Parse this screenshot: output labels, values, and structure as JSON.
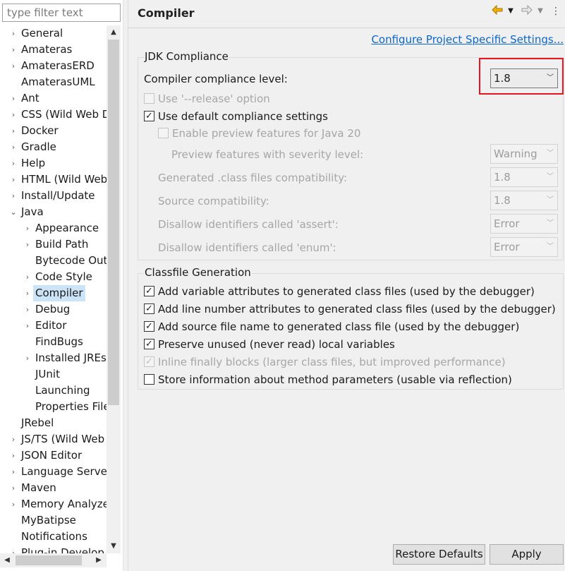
{
  "filter": {
    "placeholder": "type filter text",
    "value": ""
  },
  "tree": {
    "items": [
      {
        "label": "General",
        "expander": "›"
      },
      {
        "label": "Amateras",
        "expander": "›"
      },
      {
        "label": "AmaterasERD",
        "expander": "›"
      },
      {
        "label": "AmaterasUML",
        "expander": ""
      },
      {
        "label": "Ant",
        "expander": "›"
      },
      {
        "label": "CSS (Wild Web D",
        "expander": "›"
      },
      {
        "label": "Docker",
        "expander": "›"
      },
      {
        "label": "Gradle",
        "expander": "›"
      },
      {
        "label": "Help",
        "expander": "›"
      },
      {
        "label": "HTML (Wild Web",
        "expander": "›"
      },
      {
        "label": "Install/Update",
        "expander": "›"
      },
      {
        "label": "Java",
        "expander": "⌄"
      },
      {
        "label": "Appearance",
        "expander": "›"
      },
      {
        "label": "Build Path",
        "expander": "›"
      },
      {
        "label": "Bytecode Out",
        "expander": ""
      },
      {
        "label": "Code Style",
        "expander": "›"
      },
      {
        "label": "Compiler",
        "expander": "›"
      },
      {
        "label": "Debug",
        "expander": "›"
      },
      {
        "label": "Editor",
        "expander": "›"
      },
      {
        "label": "FindBugs",
        "expander": ""
      },
      {
        "label": "Installed JREs",
        "expander": "›"
      },
      {
        "label": "JUnit",
        "expander": ""
      },
      {
        "label": "Launching",
        "expander": ""
      },
      {
        "label": "Properties File",
        "expander": ""
      },
      {
        "label": "JRebel",
        "expander": ""
      },
      {
        "label": "JS/TS (Wild Web",
        "expander": "›"
      },
      {
        "label": "JSON Editor",
        "expander": "›"
      },
      {
        "label": "Language Server",
        "expander": "›"
      },
      {
        "label": "Maven",
        "expander": "›"
      },
      {
        "label": "Memory Analyze",
        "expander": "›"
      },
      {
        "label": "MyBatipse",
        "expander": ""
      },
      {
        "label": "Notifications",
        "expander": ""
      },
      {
        "label": "Plug-in Develop",
        "expander": "›"
      }
    ]
  },
  "page": {
    "title": "Compiler",
    "configure_link": "Configure Project Specific Settings...",
    "jdk": {
      "title": "JDK Compliance",
      "level_label": "Compiler compliance level:",
      "level_value": "1.8",
      "release_option": "Use '--release' option",
      "default_settings": "Use default compliance settings",
      "enable_preview": "Enable preview features for Java 20",
      "preview_severity_label": "Preview features with severity level:",
      "preview_severity_value": "Warning",
      "generated_label": "Generated .class files compatibility:",
      "generated_value": "1.8",
      "source_label": "Source compatibility:",
      "source_value": "1.8",
      "assert_label": "Disallow identifiers called 'assert':",
      "assert_value": "Error",
      "enum_label": "Disallow identifiers called 'enum':",
      "enum_value": "Error"
    },
    "classfile": {
      "title": "Classfile Generation",
      "items": [
        {
          "label": "Add variable attributes to generated class files (used by the debugger)",
          "checked": true,
          "disabled": false
        },
        {
          "label": "Add line number attributes to generated class files (used by the debugger)",
          "checked": true,
          "disabled": false
        },
        {
          "label": "Add source file name to generated class file (used by the debugger)",
          "checked": true,
          "disabled": false
        },
        {
          "label": "Preserve unused (never read) local variables",
          "checked": true,
          "disabled": false
        },
        {
          "label": "Inline finally blocks (larger class files, but improved performance)",
          "checked": true,
          "disabled": true
        },
        {
          "label": "Store information about method parameters (usable via reflection)",
          "checked": false,
          "disabled": false
        }
      ]
    },
    "buttons": {
      "restore": "Restore Defaults",
      "apply": "Apply"
    }
  },
  "icons": {
    "back": "back-arrow-icon",
    "forward": "forward-arrow-icon",
    "menu": "view-menu-icon",
    "accent": "#e8a000",
    "link_color": "#0a67c9",
    "highlight_color": "#e8151e"
  }
}
